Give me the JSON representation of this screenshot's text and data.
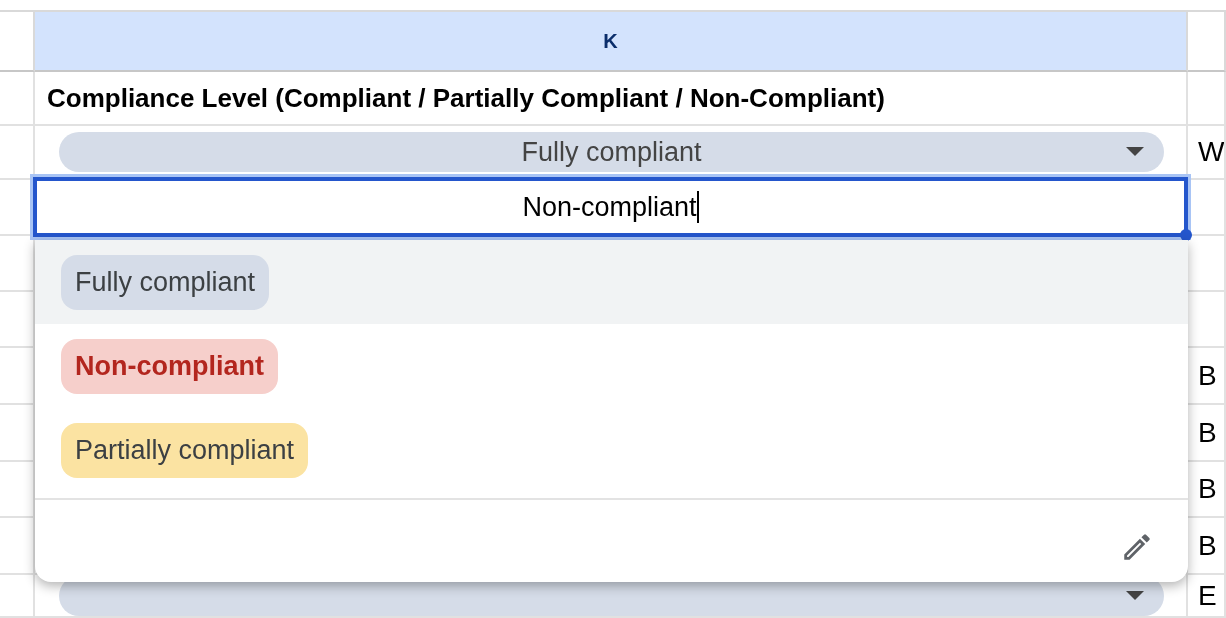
{
  "column_headers": [
    {
      "selected": false
    },
    {
      "label": "K",
      "selected": true
    },
    {
      "selected": false
    }
  ],
  "header_row": {
    "main": "Compliance Level (Compliant / Partially Compliant / Non-Compliant)"
  },
  "rows": [
    {
      "kind": "chip",
      "value": "Fully compliant",
      "right": "W"
    },
    {
      "kind": "editing",
      "value": "Non-compliant"
    },
    {
      "kind": "covered"
    },
    {
      "kind": "covered"
    },
    {
      "kind": "covered",
      "right": "B"
    },
    {
      "kind": "covered",
      "right": "B"
    },
    {
      "kind": "covered",
      "right": "B"
    },
    {
      "kind": "covered",
      "right": "B"
    },
    {
      "kind": "chip",
      "right": "E"
    }
  ],
  "dropdown": {
    "options": [
      {
        "label": "Fully compliant",
        "kind": "neutral",
        "color": "#d5dce8",
        "selected": true,
        "matched": false
      },
      {
        "label": "Non-compliant",
        "kind": "error",
        "color": "#f6cfcb",
        "selected": false,
        "matched": true
      },
      {
        "label": "Partially compliant",
        "kind": "warning",
        "color": "#fbe3a2",
        "selected": false,
        "matched": false
      }
    ]
  }
}
